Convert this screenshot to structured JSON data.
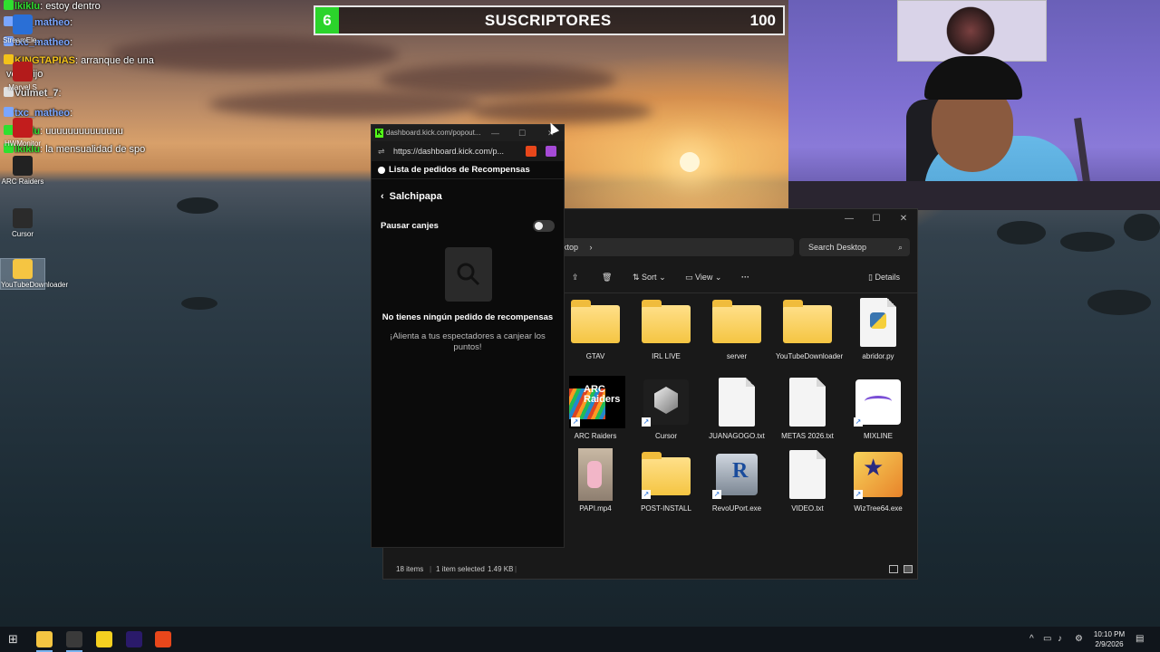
{
  "chat": [
    {
      "user": "lkiklu",
      "sep": ":",
      "message": "estoy dentro",
      "color": "#2fe02f"
    },
    {
      "user": "txc_matheo",
      "sep": ":",
      "message": "",
      "color": "#7aa6ff"
    },
    {
      "user": "txc_matheo",
      "sep": ":",
      "message": "",
      "color": "#7aa6ff"
    },
    {
      "user": "KINGTAPIAS",
      "sep": ":",
      "message": "arranque de una",
      "color": "#f3c21a"
    },
    {
      "user": "",
      "sep": "",
      "message": "vez mijo",
      "color": "#ffffff"
    },
    {
      "user": "Vulmet_7",
      "sep": ":",
      "message": "",
      "color": "#e0e0e0"
    },
    {
      "user": "txc_matheo",
      "sep": ":",
      "message": "",
      "color": "#7aa6ff"
    },
    {
      "user": "lkiklu",
      "sep": ":",
      "message": "uuuuuuuuuuuuuu",
      "color": "#2fe02f"
    },
    {
      "user": "lkiklu",
      "sep": ":",
      "message": "la mensualidad de spo",
      "color": "#2fe02f"
    }
  ],
  "desktop_icons": [
    {
      "label": "StreamEle...",
      "color": "#2a6fd6"
    },
    {
      "label": "Marvel S",
      "color": "#b31b1b"
    },
    {
      "label": "HWMonitor",
      "color": "#c21d1d"
    },
    {
      "label": "ARC Raiders",
      "color": "#222222"
    },
    {
      "label": "Cursor",
      "color": "#2b2b2b"
    },
    {
      "label": "YouTubeDownloader",
      "color": "#f5c542"
    }
  ],
  "subscriber_bar": {
    "current": "6",
    "label": "SUSCRIPTORES",
    "goal": "100",
    "progress": 0.06,
    "fill_color": "#2bd42b"
  },
  "explorer": {
    "address_tail": "ktop",
    "address_chevron": "›",
    "search_placeholder": "Search Desktop",
    "toolbar": {
      "sort": "Sort",
      "view": "View",
      "more": "···",
      "details": "Details"
    },
    "files": [
      {
        "name": "GTAV",
        "kind": "folder",
        "shortcut": false
      },
      {
        "name": "IRL LIVE",
        "kind": "folder",
        "shortcut": false
      },
      {
        "name": "server",
        "kind": "folder",
        "shortcut": false
      },
      {
        "name": "YouTubeDownloader",
        "kind": "folder",
        "shortcut": false
      },
      {
        "name": "abridor.py",
        "kind": "python",
        "shortcut": false
      },
      {
        "name": "ARC Raiders",
        "kind": "arc",
        "shortcut": true
      },
      {
        "name": "Cursor",
        "kind": "cursor",
        "shortcut": true
      },
      {
        "name": "JUANAGOGO.txt",
        "kind": "doc",
        "shortcut": false
      },
      {
        "name": "METAS 2026.txt",
        "kind": "doc",
        "shortcut": false
      },
      {
        "name": "MIXLINE",
        "kind": "mixline",
        "shortcut": true
      },
      {
        "name": "PAPI.mp4",
        "kind": "video",
        "shortcut": false
      },
      {
        "name": "POST-INSTALL",
        "kind": "folder",
        "shortcut": true
      },
      {
        "name": "RevoUPort.exe",
        "kind": "revo",
        "shortcut": true
      },
      {
        "name": "VIDEO.txt",
        "kind": "doc",
        "shortcut": false
      },
      {
        "name": "WizTree64.exe",
        "kind": "wiztree",
        "shortcut": true
      }
    ],
    "status": {
      "items": "18 items",
      "selected": "1 item selected",
      "size": "1.49 KB"
    }
  },
  "popout": {
    "tab_title": "dashboard.kick.com/popout...",
    "url": "https://dashboard.kick.com/p...",
    "header": "Lista de pedidos de Recompensas",
    "reward_name": "Salchipapa",
    "pause_label": "Pausar canjes",
    "pause_enabled": false,
    "empty_title": "No tienes ningún pedido de recompensas",
    "empty_subtitle": "¡Alienta a tus espectadores a canjear los puntos!",
    "brand_color": "#53fc18"
  },
  "taskbar": {
    "time": "10:10 PM",
    "date": "2/9/2026",
    "apps": [
      {
        "name": "file-explorer",
        "color": "#f5c542",
        "active": true
      },
      {
        "name": "obs",
        "color": "#3a3a3a",
        "active": true
      },
      {
        "name": "notes",
        "color": "#f5d020",
        "active": false
      },
      {
        "name": "premiere",
        "color": "#2a1a6a",
        "active": false
      },
      {
        "name": "brave",
        "color": "#e8471b",
        "active": false
      }
    ]
  }
}
